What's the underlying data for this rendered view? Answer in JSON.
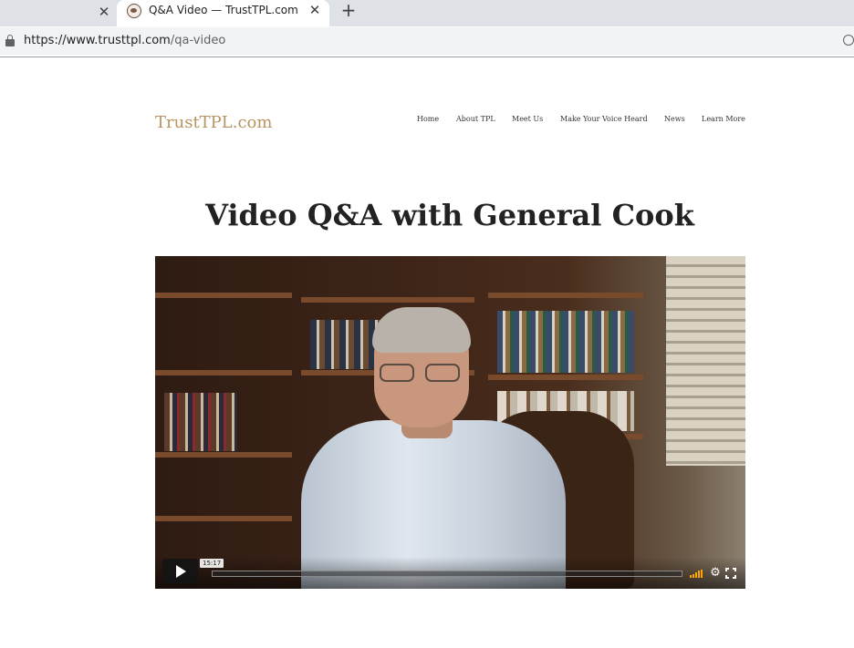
{
  "browser": {
    "tabs": [
      {
        "title": "",
        "active": false
      },
      {
        "title": "Q&A Video — TrustTPL.com",
        "active": true
      }
    ],
    "url_host": "https://www.trusttpl.com",
    "url_path": "/qa-video"
  },
  "site": {
    "logo": "TrustTPL.com",
    "nav": [
      "Home",
      "About TPL",
      "Meet Us",
      "Make Your Voice Heard",
      "News",
      "Learn More"
    ]
  },
  "page": {
    "title": "Video Q&A with General Cook"
  },
  "video": {
    "duration": "15:17",
    "progress": 0
  },
  "colors": {
    "logo": "#b79460",
    "progress_fill": "#00adef",
    "volume_bars": "#ffa500"
  }
}
